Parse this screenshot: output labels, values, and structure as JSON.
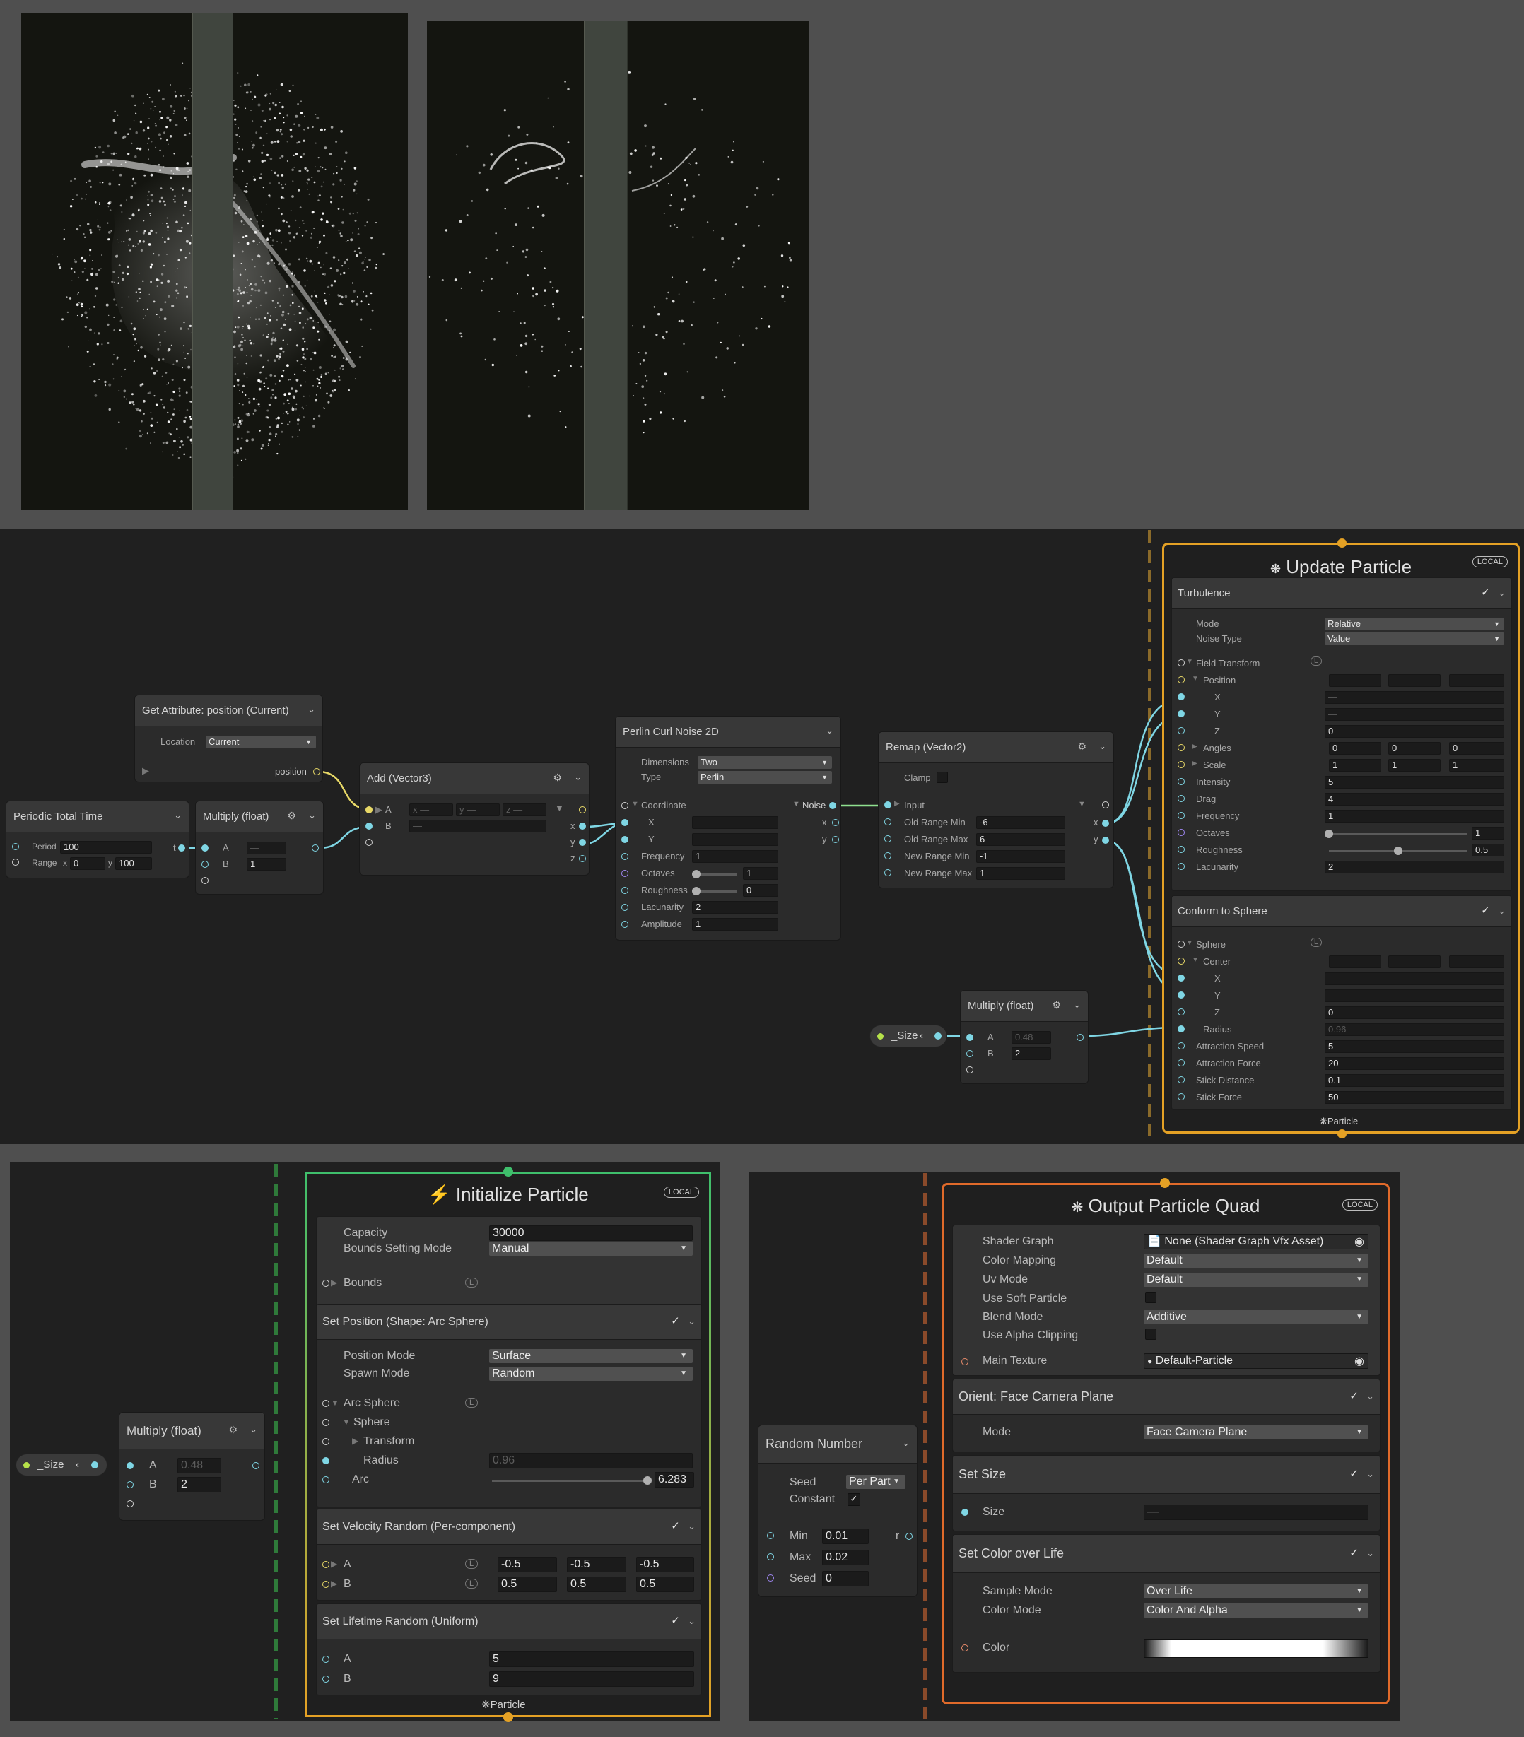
{
  "update_graph": {
    "get_attr": {
      "title": "Get Attribute: position (Current)",
      "location_label": "Location",
      "location_value": "Current",
      "out_label": "position"
    },
    "periodic": {
      "title": "Periodic Total Time",
      "period_label": "Period",
      "period_value": "100",
      "range_label": "Range",
      "range_x_label": "x",
      "range_x": "0",
      "range_y_label": "y",
      "range_y": "100",
      "out_label": "t"
    },
    "multiply1": {
      "title": "Multiply (float)",
      "a_label": "A",
      "a_value": "—",
      "b_label": "B",
      "b_value": "1"
    },
    "add": {
      "title": "Add (Vector3)",
      "a_label": "A",
      "a_x": "x —",
      "a_y": "y —",
      "a_z": "z —",
      "b_label": "B",
      "b_value": "—",
      "out_x": "x",
      "out_y": "y",
      "out_z": "z"
    },
    "curl": {
      "title": "Perlin Curl Noise 2D",
      "dimensions_label": "Dimensions",
      "dimensions_value": "Two",
      "type_label": "Type",
      "type_value": "Perlin",
      "coordinate_label": "Coordinate",
      "x_label": "X",
      "x_value": "—",
      "y_label": "Y",
      "y_value": "—",
      "frequency_label": "Frequency",
      "frequency_value": "1",
      "octaves_label": "Octaves",
      "octaves_value": "1",
      "roughness_label": "Roughness",
      "roughness_value": "0",
      "lacunarity_label": "Lacunarity",
      "lacunarity_value": "2",
      "amplitude_label": "Amplitude",
      "amplitude_value": "1",
      "out_noise": "Noise",
      "out_x": "x",
      "out_y": "y"
    },
    "remap": {
      "title": "Remap (Vector2)",
      "clamp_label": "Clamp",
      "input_label": "Input",
      "old_min_label": "Old Range Min",
      "old_min": "-6",
      "old_max_label": "Old Range Max",
      "old_max": "6",
      "new_min_label": "New Range Min",
      "new_min": "-1",
      "new_max_label": "New Range Max",
      "new_max": "1",
      "out_x": "x",
      "out_y": "y"
    },
    "size_pill": "_Size",
    "multiply2": {
      "title": "Multiply (float)",
      "a_label": "A",
      "a_value": "0.48",
      "b_label": "B",
      "b_value": "2"
    }
  },
  "update_particle": {
    "title": "Update Particle",
    "badge": "LOCAL",
    "footer": "Particle",
    "turbulence": {
      "title": "Turbulence",
      "mode_label": "Mode",
      "mode_value": "Relative",
      "noise_type_label": "Noise Type",
      "noise_type_value": "Value",
      "field_transform_label": "Field Transform",
      "position_label": "Position",
      "pos_x": "—",
      "pos_y": "—",
      "pos_z": "—",
      "x_label": "X",
      "x_value": "—",
      "y_label": "Y",
      "y_value": "—",
      "z_label": "Z",
      "z_value": "0",
      "angles_label": "Angles",
      "angles_x": "0",
      "angles_y": "0",
      "angles_z": "0",
      "scale_label": "Scale",
      "scale_x": "1",
      "scale_y": "1",
      "scale_z": "1",
      "intensity_label": "Intensity",
      "intensity_value": "5",
      "drag_label": "Drag",
      "drag_value": "4",
      "frequency_label": "Frequency",
      "frequency_value": "1",
      "octaves_label": "Octaves",
      "octaves_value": "1",
      "roughness_label": "Roughness",
      "roughness_value": "0.5",
      "lacunarity_label": "Lacunarity",
      "lacunarity_value": "2"
    },
    "conform": {
      "title": "Conform to Sphere",
      "sphere_label": "Sphere",
      "center_label": "Center",
      "center_x": "—",
      "center_y": "—",
      "center_z": "—",
      "x_label": "X",
      "x_value": "—",
      "y_label": "Y",
      "y_value": "—",
      "z_label": "Z",
      "z_value": "0",
      "radius_label": "Radius",
      "radius_value": "0.96",
      "attraction_speed_label": "Attraction Speed",
      "attraction_speed_value": "5",
      "attraction_force_label": "Attraction Force",
      "attraction_force_value": "20",
      "stick_distance_label": "Stick Distance",
      "stick_distance_value": "0.1",
      "stick_force_label": "Stick Force",
      "stick_force_value": "50"
    }
  },
  "init_graph": {
    "size_pill": "_Size",
    "multiply": {
      "title": "Multiply (float)",
      "a_label": "A",
      "a_value": "0.48",
      "b_label": "B",
      "b_value": "2"
    }
  },
  "initialize_particle": {
    "title": "Initialize Particle",
    "badge": "LOCAL",
    "footer": "Particle",
    "capacity_label": "Capacity",
    "capacity_value": "30000",
    "bounds_mode_label": "Bounds Setting Mode",
    "bounds_mode_value": "Manual",
    "bounds_label": "Bounds",
    "set_position": {
      "title": "Set Position (Shape: Arc Sphere)",
      "position_mode_label": "Position Mode",
      "position_mode_value": "Surface",
      "spawn_mode_label": "Spawn Mode",
      "spawn_mode_value": "Random",
      "arc_sphere_label": "Arc Sphere",
      "sphere_label": "Sphere",
      "transform_label": "Transform",
      "radius_label": "Radius",
      "radius_value": "0.96",
      "arc_label": "Arc",
      "arc_value": "6.283"
    },
    "set_velocity": {
      "title": "Set Velocity Random (Per-component)",
      "a_label": "A",
      "a_x": "-0.5",
      "a_y": "-0.5",
      "a_z": "-0.5",
      "b_label": "B",
      "b_x": "0.5",
      "b_y": "0.5",
      "b_z": "0.5"
    },
    "set_lifetime": {
      "title": "Set Lifetime Random (Uniform)",
      "a_label": "A",
      "a_value": "5",
      "b_label": "B",
      "b_value": "9"
    }
  },
  "output_graph": {
    "random": {
      "title": "Random Number",
      "seed_label": "Seed",
      "seed_value": "Per Part",
      "constant_label": "Constant",
      "min_label": "Min",
      "min_value": "0.01",
      "max_label": "Max",
      "max_value": "0.02",
      "seed2_label": "Seed",
      "seed2_value": "0",
      "out_label": "r"
    }
  },
  "output_quad": {
    "title": "Output Particle Quad",
    "badge": "LOCAL",
    "shader_graph_label": "Shader Graph",
    "shader_graph_value": "None (Shader Graph Vfx Asset)",
    "color_mapping_label": "Color Mapping",
    "color_mapping_value": "Default",
    "uv_mode_label": "Uv Mode",
    "uv_mode_value": "Default",
    "soft_particle_label": "Use Soft Particle",
    "blend_mode_label": "Blend Mode",
    "blend_mode_value": "Additive",
    "alpha_clipping_label": "Use Alpha Clipping",
    "main_texture_label": "Main Texture",
    "main_texture_value": "Default-Particle",
    "orient": {
      "title": "Orient: Face Camera Plane",
      "mode_label": "Mode",
      "mode_value": "Face Camera Plane"
    },
    "set_size": {
      "title": "Set Size",
      "size_label": "Size",
      "size_value": "—"
    },
    "color_life": {
      "title": "Set Color over Life",
      "sample_mode_label": "Sample Mode",
      "sample_mode_value": "Over Life",
      "color_mode_label": "Color Mode",
      "color_mode_value": "Color And Alpha",
      "color_label": "Color"
    }
  },
  "colors": {
    "context_border": "#e4a125",
    "init_border": "#3fbf6c",
    "float_port": "#7fd6e4",
    "vector_port": "#e7d867",
    "dashed_update": "#8a6a2a",
    "dashed_init": "#2f7a3a",
    "dashed_output": "#8a4a2a"
  }
}
